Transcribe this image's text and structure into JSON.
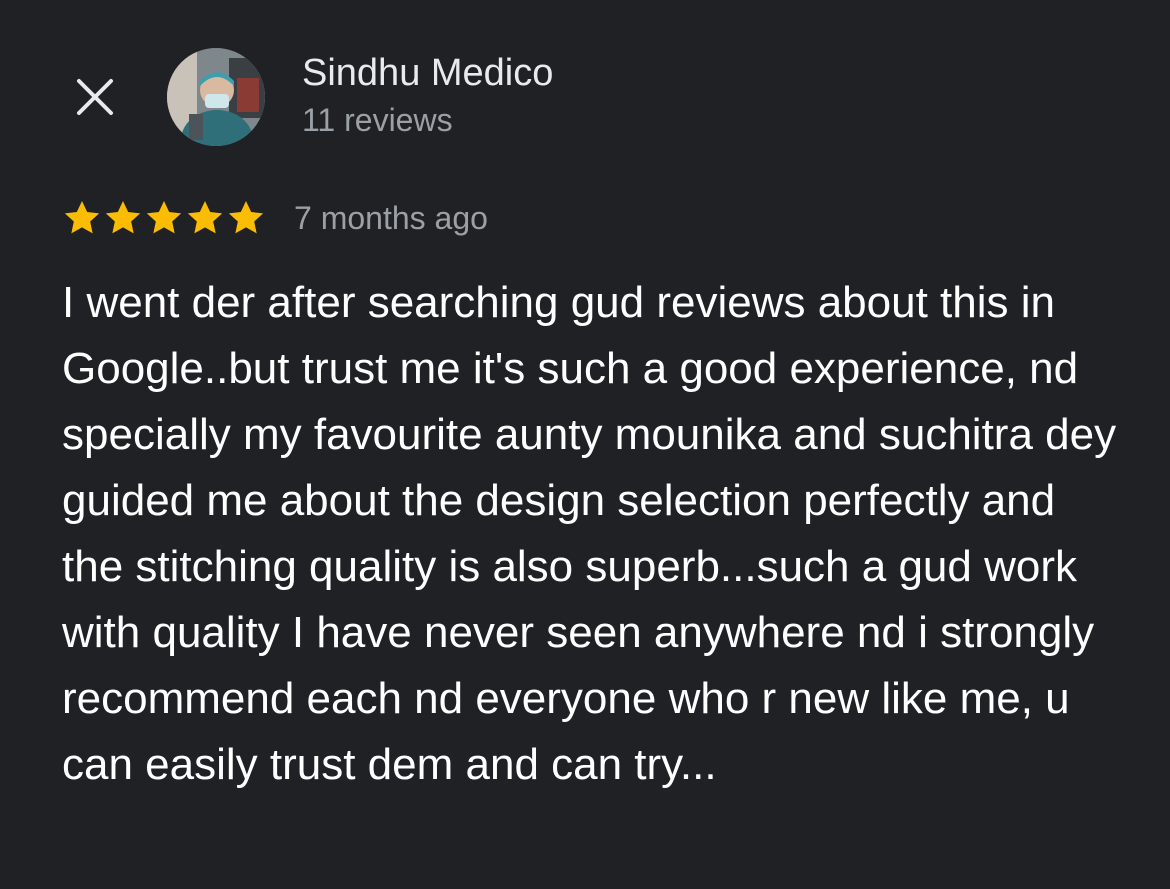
{
  "header": {
    "close_icon": "close-icon",
    "author_name": "Sindhu Medico",
    "review_count": "11 reviews",
    "avatar_icon": "profile-photo"
  },
  "review": {
    "rating": 5,
    "rating_max": 5,
    "star_color": "#fbbc04",
    "time": "7 months ago",
    "text": "I went der after searching gud reviews about this in Google..but trust me it's such a good experience, nd specially my favourite aunty mounika and suchitra dey guided me about the design selection perfectly and the stitching quality is also superb...such a gud work with quality I have never seen anywhere nd i strongly recommend each nd everyone who r new like me, u can easily trust dem and can try..."
  },
  "colors": {
    "background": "#202124",
    "primary_text": "#e8eaed",
    "secondary_text": "#9aa0a6"
  }
}
